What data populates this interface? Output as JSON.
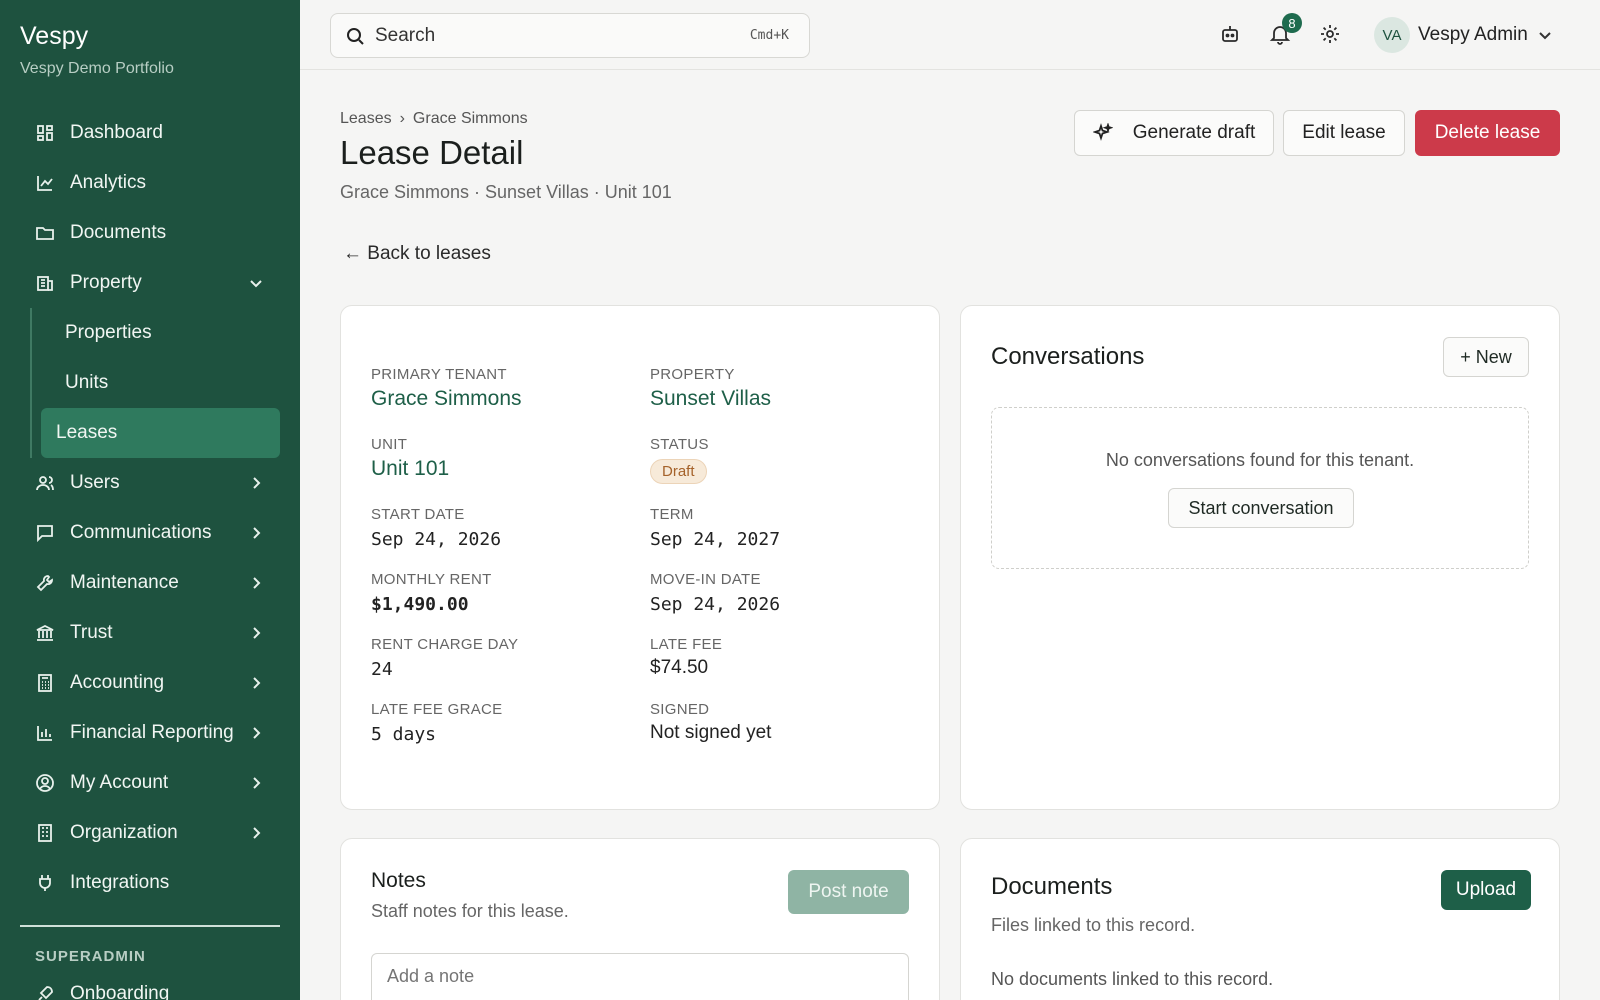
{
  "sidebar": {
    "brand": "Vespy",
    "portfolio": "Vespy Demo Portfolio",
    "items": [
      {
        "label": "Dashboard",
        "icon": "dashboard-icon"
      },
      {
        "label": "Analytics",
        "icon": "chart-line-icon"
      },
      {
        "label": "Documents",
        "icon": "folder-icon"
      },
      {
        "label": "Property",
        "icon": "building-icon",
        "expanded": true
      },
      {
        "label": "Users",
        "icon": "users-icon"
      },
      {
        "label": "Communications",
        "icon": "message-icon"
      },
      {
        "label": "Maintenance",
        "icon": "wrench-icon"
      },
      {
        "label": "Trust",
        "icon": "bank-icon"
      },
      {
        "label": "Accounting",
        "icon": "calculator-icon"
      },
      {
        "label": "Financial Reporting",
        "icon": "bar-chart-icon"
      },
      {
        "label": "My Account",
        "icon": "user-circle-icon"
      },
      {
        "label": "Organization",
        "icon": "office-icon"
      },
      {
        "label": "Integrations",
        "icon": "plug-icon"
      }
    ],
    "property_sub": [
      {
        "label": "Properties"
      },
      {
        "label": "Units"
      },
      {
        "label": "Leases",
        "active": true
      }
    ],
    "section_label": "SUPERADMIN",
    "onboarding": "Onboarding"
  },
  "topbar": {
    "search_placeholder": "Search",
    "shortcut": "Cmd+K",
    "notification_count": "8",
    "avatar_initials": "VA",
    "user_name": "Vespy Admin"
  },
  "header": {
    "breadcrumb": [
      "Leases",
      "›",
      "Grace Simmons"
    ],
    "title": "Lease Detail",
    "subtitle": "Grace Simmons · Sunset Villas · Unit 101",
    "back_link": "← Back to leases",
    "generate_label": "Generate draft",
    "edit_label": "Edit lease",
    "delete_label": "Delete lease"
  },
  "lease": {
    "primary_tenant": {
      "label": "PRIMARY TENANT",
      "value": "Grace Simmons"
    },
    "property": {
      "label": "PROPERTY",
      "value": "Sunset Villas"
    },
    "unit": {
      "label": "UNIT",
      "value": "Unit 101"
    },
    "status": {
      "label": "STATUS",
      "value": "Draft"
    },
    "start_date": {
      "label": "START DATE",
      "value": "Sep 24, 2026"
    },
    "term": {
      "label": "TERM",
      "value": "Sep 24, 2027"
    },
    "monthly_rent": {
      "label": "MONTHLY RENT",
      "value": "$1,490.00"
    },
    "move_in": {
      "label": "MOVE-IN DATE",
      "value": "Sep 24, 2026"
    },
    "rent_charge_day": {
      "label": "RENT CHARGE DAY",
      "value": "24"
    },
    "late_fee": {
      "label": "LATE FEE",
      "value": "$74.50"
    },
    "late_fee_grace": {
      "label": "LATE FEE GRACE",
      "value": "5 days"
    },
    "signed": {
      "label": "SIGNED",
      "value": "Not signed yet"
    }
  },
  "conversations": {
    "title": "Conversations",
    "new_label": "+ New",
    "empty_message": "No conversations found for this tenant.",
    "start_label": "Start conversation"
  },
  "notes": {
    "title": "Notes",
    "subtitle": "Staff notes for this lease.",
    "post_label": "Post note",
    "input_placeholder": "Add a note"
  },
  "documents": {
    "title": "Documents",
    "subtitle": "Files linked to this record.",
    "upload_label": "Upload",
    "empty_message": "No documents linked to this record."
  },
  "colors": {
    "sidebar_bg": "#1e523f",
    "accent": "#1e5f48",
    "danger": "#cc3a4a",
    "draft_badge": "#f7ead9"
  }
}
